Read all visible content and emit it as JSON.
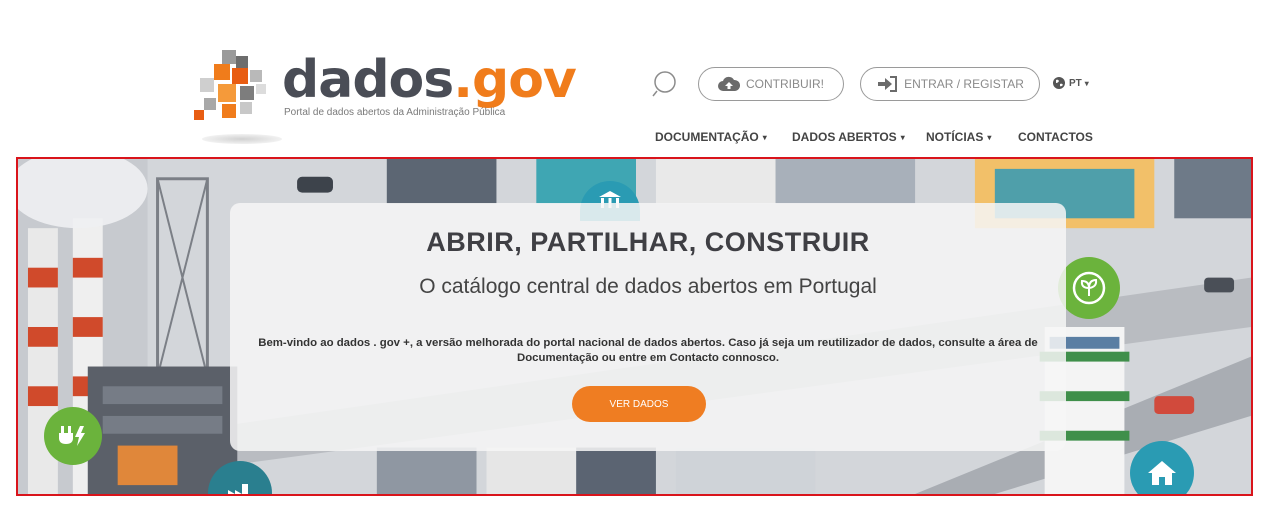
{
  "brand": {
    "logo_part1": "dados",
    "logo_part2": ".gov",
    "tagline": "Portal de dados abertos da Administração Pública",
    "colors": {
      "dark": "#4a4d56",
      "orange": "#f07c1b"
    }
  },
  "header": {
    "search_icon": "search-icon",
    "contribuir_label": "CONTRIBUIR!",
    "entrar_label": "ENTRAR / REGISTAR",
    "language": "PT"
  },
  "nav": {
    "items": [
      {
        "label": "DOCUMENTAÇÃO",
        "has_dropdown": true
      },
      {
        "label": "DADOS ABERTOS",
        "has_dropdown": true
      },
      {
        "label": "NOTÍCIAS",
        "has_dropdown": true
      },
      {
        "label": "CONTACTOS",
        "has_dropdown": false
      }
    ]
  },
  "hero": {
    "title": "ABRIR, PARTILHAR, CONSTRUIR",
    "subtitle": "O catálogo central de dados abertos em Portugal",
    "description": "Bem-vindo ao dados . gov +, a versão melhorada do portal nacional de dados abertos. Caso já seja um reutilizador de dados, consulte a área de Documentação ou entre em Contacto connosco.",
    "cta_label": "VER DADOS",
    "accent": "#ef7d22",
    "badges": [
      "plug-icon",
      "plant-icon",
      "home-icon",
      "factory-icon",
      "bank-icon"
    ]
  }
}
